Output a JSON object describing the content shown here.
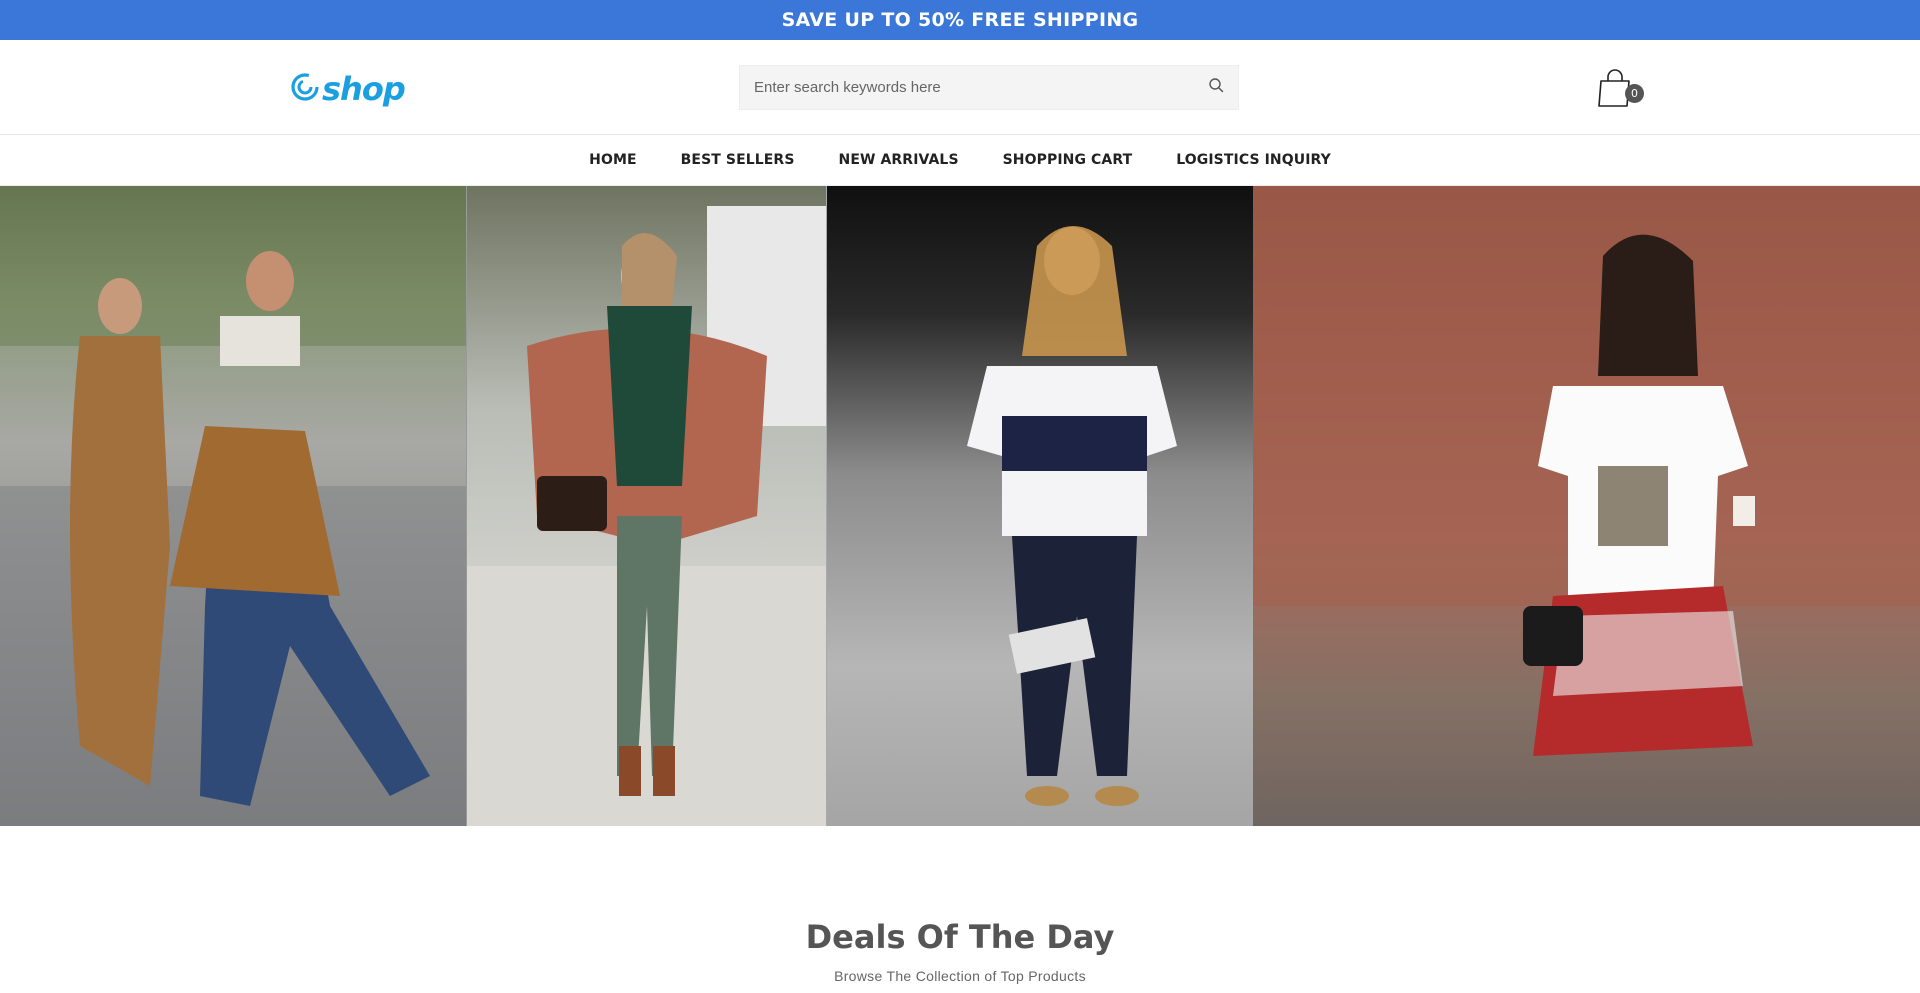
{
  "promo": {
    "text": "SAVE UP TO 50% FREE SHIPPING"
  },
  "header": {
    "logo_text": "shop",
    "search": {
      "placeholder": "Enter search keywords here",
      "value": ""
    },
    "cart": {
      "count": "0"
    }
  },
  "nav": {
    "items": [
      {
        "label": "HOME"
      },
      {
        "label": "BEST SELLERS"
      },
      {
        "label": "NEW ARRIVALS"
      },
      {
        "label": "SHOPPING CART"
      },
      {
        "label": "LOGISTICS INQUIRY"
      }
    ]
  },
  "deals": {
    "title": "Deals Of The Day",
    "subtitle": "Browse The Collection of Top Products"
  },
  "colors": {
    "promo_bg": "#3a77d8",
    "logo": "#1a9fe0",
    "cart_badge": "#555555"
  }
}
